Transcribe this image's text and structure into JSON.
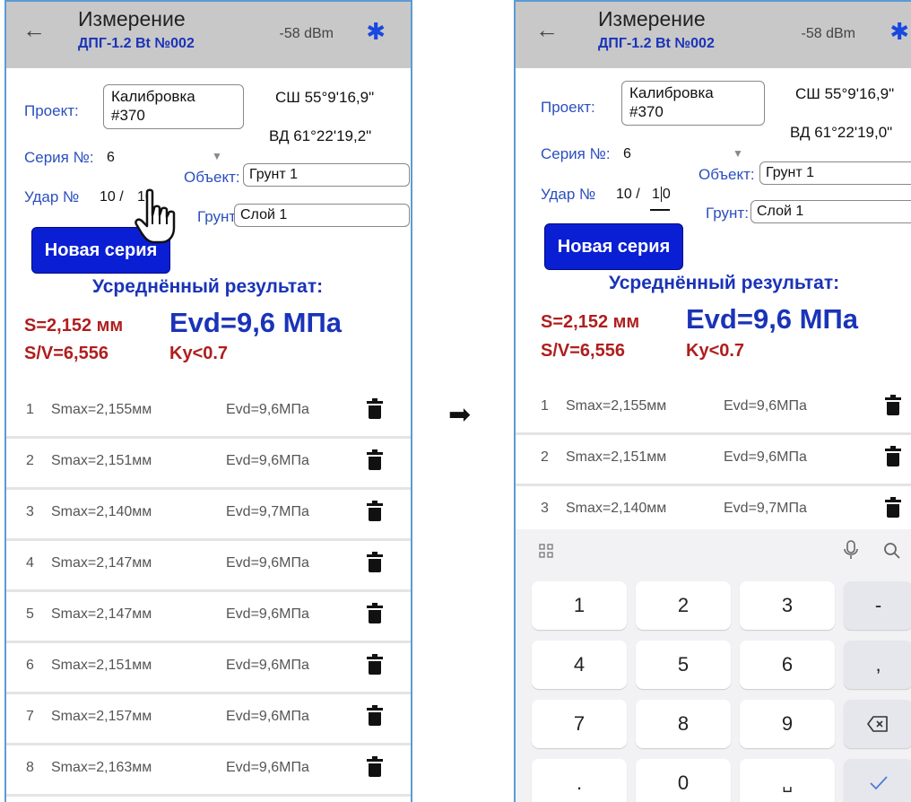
{
  "left": {
    "header": {
      "back_icon": "arrow-left-icon",
      "title": "Измерение",
      "subtitle": "ДПГ-1.2 Bt №002",
      "rssi": "-58 dBm",
      "bluetooth_icon": "bluetooth-icon"
    },
    "project": {
      "label": "Проект:",
      "value_line1": "Калибровка",
      "value_line2": "#370"
    },
    "coords": {
      "lat": "СШ 55°9'16,9\"",
      "lon": "ВД 61°22'19,2\""
    },
    "series": {
      "label": "Серия №:",
      "value": "6"
    },
    "object": {
      "label": "Объект:",
      "value": "Грунт 1"
    },
    "impact": {
      "label": "Удар №",
      "value": "10 /",
      "total": "10"
    },
    "soil": {
      "label": "Грунт:",
      "value": "Слой 1"
    },
    "new_series_button": "Новая серия",
    "average_title": "Усреднённый результат:",
    "s_value": "S=2,152 мм",
    "sv_value": "S/V=6,556",
    "evd_value": "Evd=9,6 МПа",
    "ky_value": "Ky<0.7",
    "rows": [
      {
        "num": "1",
        "smax": "Smax=2,155мм",
        "evd": "Evd=9,6МПа"
      },
      {
        "num": "2",
        "smax": "Smax=2,151мм",
        "evd": "Evd=9,6МПа"
      },
      {
        "num": "3",
        "smax": "Smax=2,140мм",
        "evd": "Evd=9,7МПа"
      },
      {
        "num": "4",
        "smax": "Smax=2,147мм",
        "evd": "Evd=9,6МПа"
      },
      {
        "num": "5",
        "smax": "Smax=2,147мм",
        "evd": "Evd=9,6МПа"
      },
      {
        "num": "6",
        "smax": "Smax=2,151мм",
        "evd": "Evd=9,6МПа"
      },
      {
        "num": "7",
        "smax": "Smax=2,157мм",
        "evd": "Evd=9,6МПа"
      },
      {
        "num": "8",
        "smax": "Smax=2,163мм",
        "evd": "Evd=9,6МПа"
      }
    ]
  },
  "right": {
    "header": {
      "title": "Измерение",
      "subtitle": "ДПГ-1.2 Bt №002",
      "rssi": "-58 dBm"
    },
    "project": {
      "label": "Проект:",
      "value_line1": "Калибровка",
      "value_line2": "#370"
    },
    "coords": {
      "lat": "СШ 55°9'16,9\"",
      "lon": "ВД 61°22'19,0\""
    },
    "series": {
      "label": "Серия №:",
      "value": "6"
    },
    "object": {
      "label": "Объект:",
      "value": "Грунт 1"
    },
    "impact": {
      "label": "Удар №",
      "value": "10 /",
      "total_a": "1",
      "total_b": "0"
    },
    "soil": {
      "label": "Грунт:",
      "value": "Слой 1"
    },
    "new_series_button": "Новая серия",
    "average_title": "Усреднённый результат:",
    "s_value": "S=2,152 мм",
    "sv_value": "S/V=6,556",
    "evd_value": "Evd=9,6 МПа",
    "ky_value": "Ky<0.7",
    "rows": [
      {
        "num": "1",
        "smax": "Smax=2,155мм",
        "evd": "Evd=9,6МПа"
      },
      {
        "num": "2",
        "smax": "Smax=2,151мм",
        "evd": "Evd=9,6МПа"
      },
      {
        "num": "3",
        "smax": "Smax=2,140мм",
        "evd": "Evd=9,7МПа"
      }
    ],
    "keyboard": {
      "keys": [
        "1",
        "2",
        "3",
        "-",
        "4",
        "5",
        "6",
        ",",
        "7",
        "8",
        "9",
        ".",
        "0",
        "␣"
      ],
      "backspace_icon": "backspace-icon",
      "done_icon": "checkmark-icon",
      "grid_icon": "grid-icon",
      "mic_icon": "microphone-icon",
      "search_icon": "search-icon"
    }
  },
  "colors": {
    "accent_blue": "#1a33b8",
    "button_blue": "#0a1fd4",
    "result_red": "#b01e1e",
    "header_gray": "#c8c8c8"
  },
  "transition_icon": "arrow-right-icon"
}
